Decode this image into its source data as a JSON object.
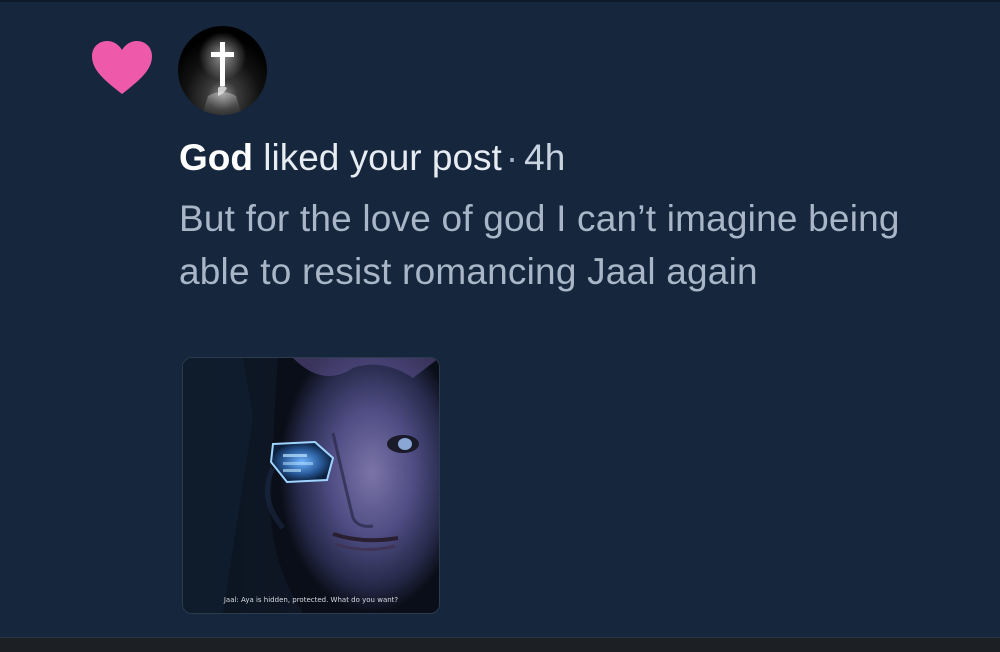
{
  "notification": {
    "icon": "heart-icon",
    "user_name": "God",
    "action": " liked your post",
    "separator": "·",
    "timestamp": "4h",
    "post_text": "But for the love of god I can’t imagine being able to resist romancing Jaal again",
    "image_caption": "Jaal: Aya is hidden, protected. What do you want?"
  },
  "colors": {
    "background": "#15263d",
    "heart": "#ee5aa9",
    "primary_text": "#e7ecf2",
    "secondary_text": "#a9b6c7"
  }
}
